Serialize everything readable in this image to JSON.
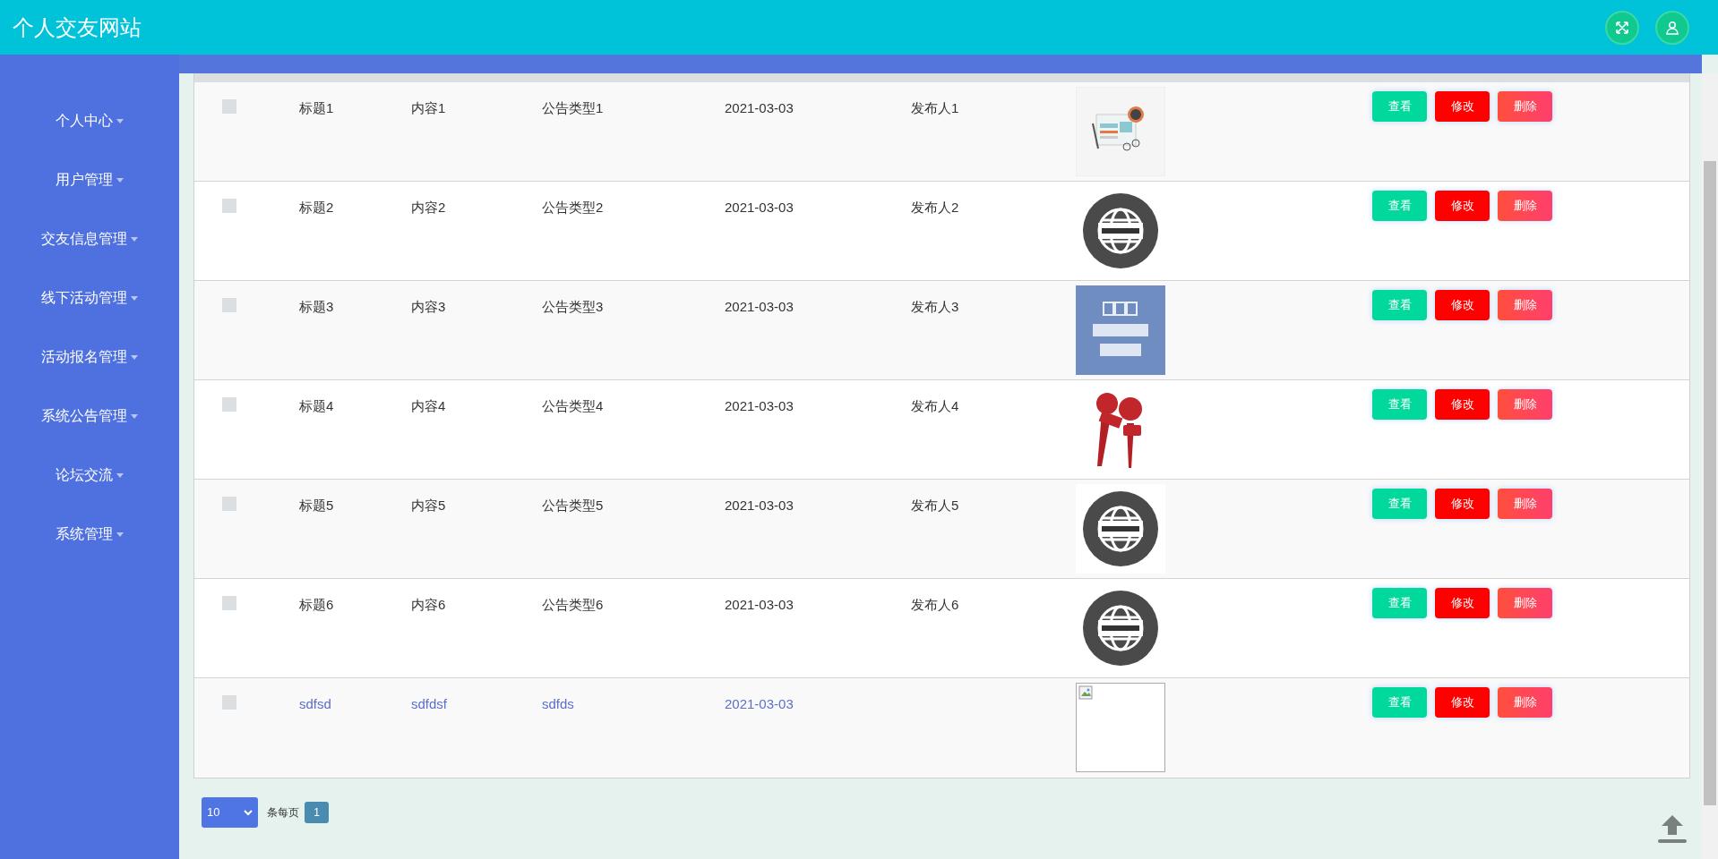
{
  "header": {
    "title": "个人交友网站"
  },
  "sidebar": {
    "items": [
      {
        "label": "个人中心"
      },
      {
        "label": "用户管理"
      },
      {
        "label": "交友信息管理"
      },
      {
        "label": "线下活动管理"
      },
      {
        "label": "活动报名管理"
      },
      {
        "label": "系统公告管理"
      },
      {
        "label": "论坛交流"
      },
      {
        "label": "系统管理"
      }
    ]
  },
  "table": {
    "rows": [
      {
        "checked": false,
        "linked": false,
        "title": "标题1",
        "content": "内容1",
        "type": "公告类型1",
        "date": "2021-03-03",
        "publisher": "发布人1",
        "image": {
          "kind": "newspaper"
        },
        "actions": [
          "查看",
          "修改",
          "删除"
        ]
      },
      {
        "checked": false,
        "linked": false,
        "title": "标题2",
        "content": "内容2",
        "type": "公告类型2",
        "date": "2021-03-03",
        "publisher": "发布人2",
        "image": {
          "kind": "globe"
        },
        "actions": [
          "查看",
          "修改",
          "删除"
        ]
      },
      {
        "checked": false,
        "linked": false,
        "title": "标题3",
        "content": "内容3",
        "type": "公告类型3",
        "date": "2021-03-03",
        "publisher": "发布人3",
        "image": {
          "kind": "banner"
        },
        "actions": [
          "查看",
          "修改",
          "删除"
        ]
      },
      {
        "checked": false,
        "linked": false,
        "title": "标题4",
        "content": "内容4",
        "type": "公告类型4",
        "date": "2021-03-03",
        "publisher": "发布人4",
        "image": {
          "kind": "microphones"
        },
        "actions": [
          "查看",
          "修改",
          "删除"
        ]
      },
      {
        "checked": false,
        "linked": false,
        "title": "标题5",
        "content": "内容5",
        "type": "公告类型5",
        "date": "2021-03-03",
        "publisher": "发布人5",
        "image": {
          "kind": "globe"
        },
        "actions": [
          "查看",
          "修改",
          "删除"
        ]
      },
      {
        "checked": false,
        "linked": false,
        "title": "标题6",
        "content": "内容6",
        "type": "公告类型6",
        "date": "2021-03-03",
        "publisher": "发布人6",
        "image": {
          "kind": "globe"
        },
        "actions": [
          "查看",
          "修改",
          "删除"
        ]
      },
      {
        "checked": false,
        "linked": true,
        "title": "sdfsd",
        "content": "sdfdsf",
        "type": "sdfds",
        "date": "2021-03-03",
        "image": {
          "kind": "broken"
        },
        "actions": [
          "查看",
          "修改",
          "删除"
        ]
      }
    ]
  },
  "pagination": {
    "page_size": "10",
    "per_page_label": "条每页",
    "pages": [
      {
        "label": "1",
        "selected": true
      }
    ]
  }
}
